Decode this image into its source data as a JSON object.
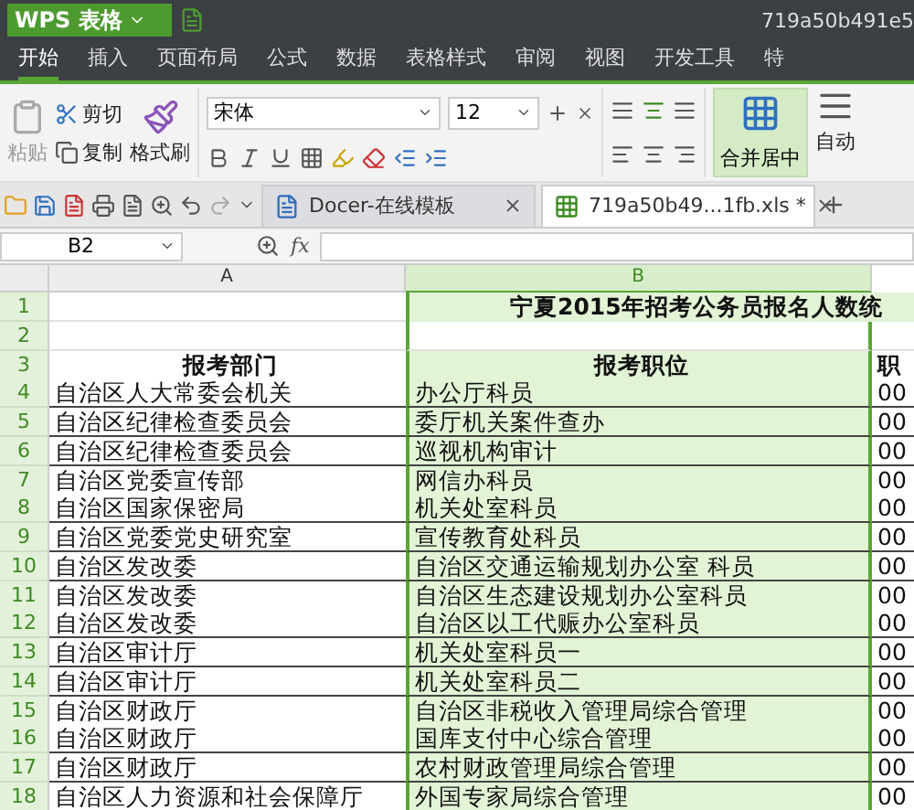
{
  "app_button": {
    "label": "WPS 表格"
  },
  "document_title": "719a50b491e5",
  "menu_tabs": [
    {
      "label": "开始",
      "selected": true
    },
    {
      "label": "插入",
      "selected": false
    },
    {
      "label": "页面布局",
      "selected": false
    },
    {
      "label": "公式",
      "selected": false
    },
    {
      "label": "数据",
      "selected": false
    },
    {
      "label": "表格样式",
      "selected": false
    },
    {
      "label": "审阅",
      "selected": false
    },
    {
      "label": "视图",
      "selected": false
    },
    {
      "label": "开发工具",
      "selected": false
    },
    {
      "label": "特",
      "selected": false
    }
  ],
  "ribbon": {
    "paste": "粘贴",
    "cut": "剪切",
    "copy": "复制",
    "format_painter": "格式刷",
    "font_name": "宋体",
    "font_size": "12",
    "merge_center": "合并居中",
    "wrap": "自动"
  },
  "doc_tabs": [
    {
      "label": "Docer-在线模板",
      "kind": "docer",
      "selected": false
    },
    {
      "label": "719a50b49...1fb.xls *",
      "kind": "sheet",
      "selected": true
    }
  ],
  "name_box": "B2",
  "formula_label": "fx",
  "columns": [
    {
      "label": "A",
      "selected": false
    },
    {
      "label": "B",
      "selected": true
    }
  ],
  "rows": [
    {
      "number": "1",
      "kind": "title",
      "cells": [
        "",
        "宁夏2015年招考公务员报名人数统"
      ]
    },
    {
      "number": "2",
      "kind": "blank",
      "cells": [
        "",
        "",
        ""
      ]
    },
    {
      "number": "3",
      "kind": "header",
      "cells": [
        "报考部门",
        "报考职位",
        "职"
      ]
    },
    {
      "number": "4",
      "kind": "data",
      "cells": [
        "自治区人大常委会机关",
        "办公厅科员",
        "00"
      ]
    },
    {
      "number": "5",
      "kind": "data",
      "cells": [
        "自治区纪律检查委员会",
        "委厅机关案件查办",
        "00"
      ]
    },
    {
      "number": "6",
      "kind": "data",
      "cells": [
        "自治区纪律检查委员会",
        "巡视机构审计",
        "00"
      ]
    },
    {
      "number": "7",
      "kind": "data",
      "cells": [
        "自治区党委宣传部",
        "网信办科员",
        "00"
      ]
    },
    {
      "number": "8",
      "kind": "data",
      "cells": [
        "自治区国家保密局",
        "机关处室科员",
        "00"
      ]
    },
    {
      "number": "9",
      "kind": "data",
      "cells": [
        "自治区党委党史研究室",
        "宣传教育处科员",
        "00"
      ]
    },
    {
      "number": "10",
      "kind": "data",
      "cells": [
        "自治区发改委",
        "自治区交通运输规划办公室 科员",
        "00"
      ]
    },
    {
      "number": "11",
      "kind": "data",
      "cells": [
        "自治区发改委",
        "自治区生态建设规划办公室科员",
        "00"
      ]
    },
    {
      "number": "12",
      "kind": "data",
      "cells": [
        "自治区发改委",
        "自治区以工代赈办公室科员",
        "00"
      ]
    },
    {
      "number": "13",
      "kind": "data",
      "cells": [
        "自治区审计厅",
        "机关处室科员一",
        "00"
      ]
    },
    {
      "number": "14",
      "kind": "data",
      "cells": [
        "自治区审计厅",
        "机关处室科员二",
        "00"
      ]
    },
    {
      "number": "15",
      "kind": "data",
      "cells": [
        "自治区财政厅",
        "自治区非税收入管理局综合管理",
        "00"
      ]
    },
    {
      "number": "16",
      "kind": "data",
      "cells": [
        "自治区财政厅",
        "国库支付中心综合管理",
        "00"
      ]
    },
    {
      "number": "17",
      "kind": "data",
      "cells": [
        "自治区财政厅",
        "农村财政管理局综合管理",
        "00"
      ]
    },
    {
      "number": "18",
      "kind": "data",
      "cells": [
        "自治区人力资源和社会保障厅",
        "外国专家局综合管理",
        "00"
      ]
    }
  ]
}
